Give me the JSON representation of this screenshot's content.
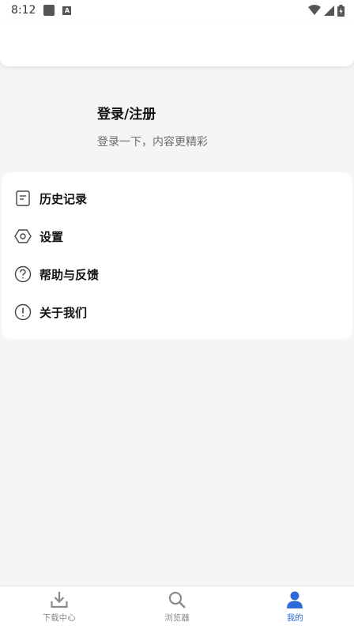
{
  "status_bar": {
    "time": "8:12"
  },
  "profile": {
    "title": "登录/注册",
    "subtitle": "登录一下，内容更精彩"
  },
  "menu": {
    "items": [
      {
        "label": "历史记录",
        "icon": "history-icon"
      },
      {
        "label": "设置",
        "icon": "settings-icon"
      },
      {
        "label": "帮助与反馈",
        "icon": "help-icon"
      },
      {
        "label": "关于我们",
        "icon": "info-icon"
      }
    ]
  },
  "tabs": [
    {
      "label": "下载中心",
      "icon": "download-icon",
      "active": false
    },
    {
      "label": "浏览器",
      "icon": "search-icon",
      "active": false
    },
    {
      "label": "我的",
      "icon": "user-icon",
      "active": true
    }
  ],
  "colors": {
    "accent": "#2f6bd8",
    "background": "#f5f5f5",
    "inactive": "#8a8a8a"
  }
}
